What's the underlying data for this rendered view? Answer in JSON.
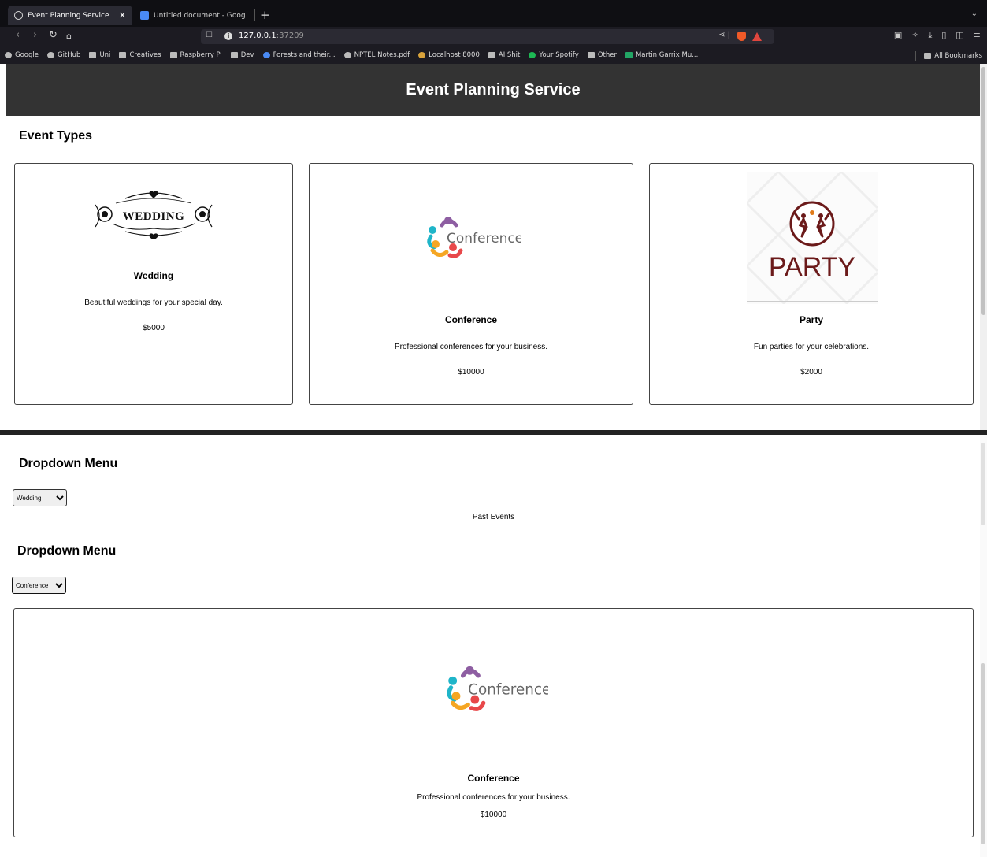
{
  "browser": {
    "tabs": [
      {
        "title": "Event Planning Service",
        "active": true
      },
      {
        "title": "Untitled document - Google Doc",
        "active": false
      }
    ],
    "url_host": "127.0.0.1",
    "url_port": ":37209",
    "bookmarks": [
      "Google",
      "GitHub",
      "Uni",
      "Creatives",
      "Raspberry Pi",
      "Dev",
      "Forests and their...",
      "NPTEL Notes.pdf",
      "Localhost 8000",
      "AI Shit",
      "Your Spotify",
      "Other",
      "Martin Garrix Mu..."
    ],
    "all_bookmarks": "All Bookmarks"
  },
  "header": {
    "title": "Event Planning Service"
  },
  "event_types": {
    "title": "Event Types",
    "cards": [
      {
        "name": "Wedding",
        "description": "Beautiful weddings for your special day.",
        "price": "$5000",
        "logo_text": "WEDDING"
      },
      {
        "name": "Conference",
        "description": "Professional conferences for your business.",
        "price": "$10000",
        "logo_text": "Conference"
      },
      {
        "name": "Party",
        "description": "Fun parties for your celebrations.",
        "price": "$2000",
        "logo_text": "PARTY"
      }
    ]
  },
  "dropdown1": {
    "title": "Dropdown Menu",
    "selected": "Wedding"
  },
  "past_events": "Past Events",
  "dropdown2": {
    "title": "Dropdown Menu",
    "selected": "Conference"
  },
  "selected_card": {
    "name": "Conference",
    "description": "Professional conferences for your business.",
    "price": "$10000",
    "logo_text": "Conference"
  },
  "colors": {
    "header_bg": "#333333",
    "party_maroon": "#6b1a1a",
    "conf_purple": "#8e5ea2",
    "conf_cyan": "#1fb5c9",
    "conf_orange": "#f5a623",
    "conf_red": "#e8484a"
  }
}
